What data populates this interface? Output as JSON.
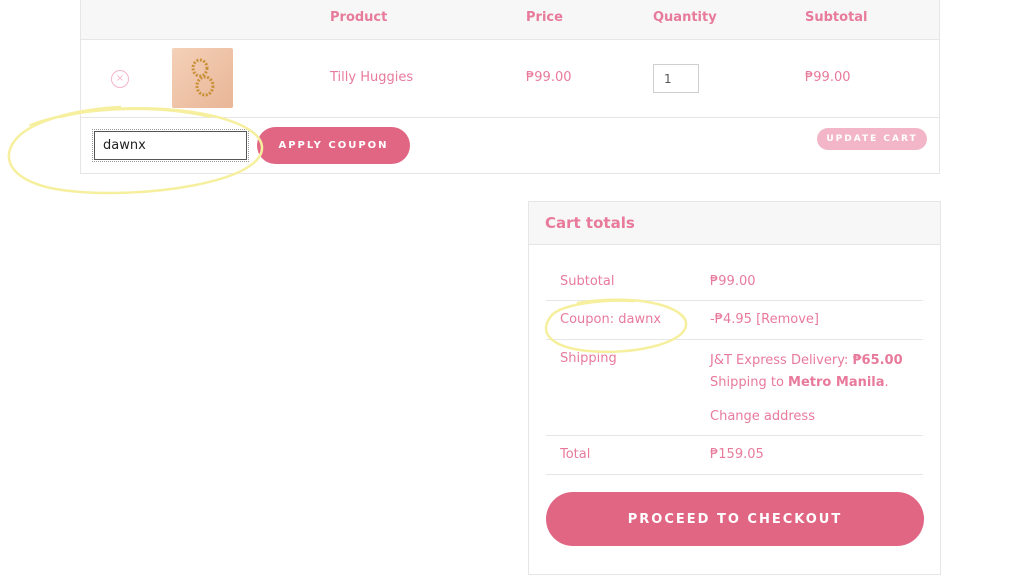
{
  "cart": {
    "headers": {
      "product": "Product",
      "price": "Price",
      "quantity": "Quantity",
      "subtotal": "Subtotal"
    },
    "item": {
      "remove_symbol": "×",
      "name": "Tilly Huggies",
      "price": "₱99.00",
      "quantity": "1",
      "subtotal": "₱99.00"
    },
    "coupon": {
      "value": "dawnx",
      "apply_label": "APPLY COUPON"
    },
    "update_label": "UPDATE CART"
  },
  "totals": {
    "title": "Cart totals",
    "subtotal_label": "Subtotal",
    "subtotal_value": "₱99.00",
    "coupon_label": "Coupon: dawnx",
    "coupon_amount": "-₱4.95",
    "coupon_remove": "[Remove]",
    "shipping_label": "Shipping",
    "shipping_method": "J&T Express Delivery:",
    "shipping_cost": "₱65.00",
    "shipping_to_prefix": "Shipping to",
    "shipping_region": "Metro Manila",
    "change_address": "Change address",
    "total_label": "Total",
    "total_value": "₱159.05",
    "checkout_label": "PROCEED TO CHECKOUT"
  },
  "colors": {
    "accent": "#e06684",
    "text_pink": "#e87a9c",
    "highlight": "#f6ef9e"
  }
}
